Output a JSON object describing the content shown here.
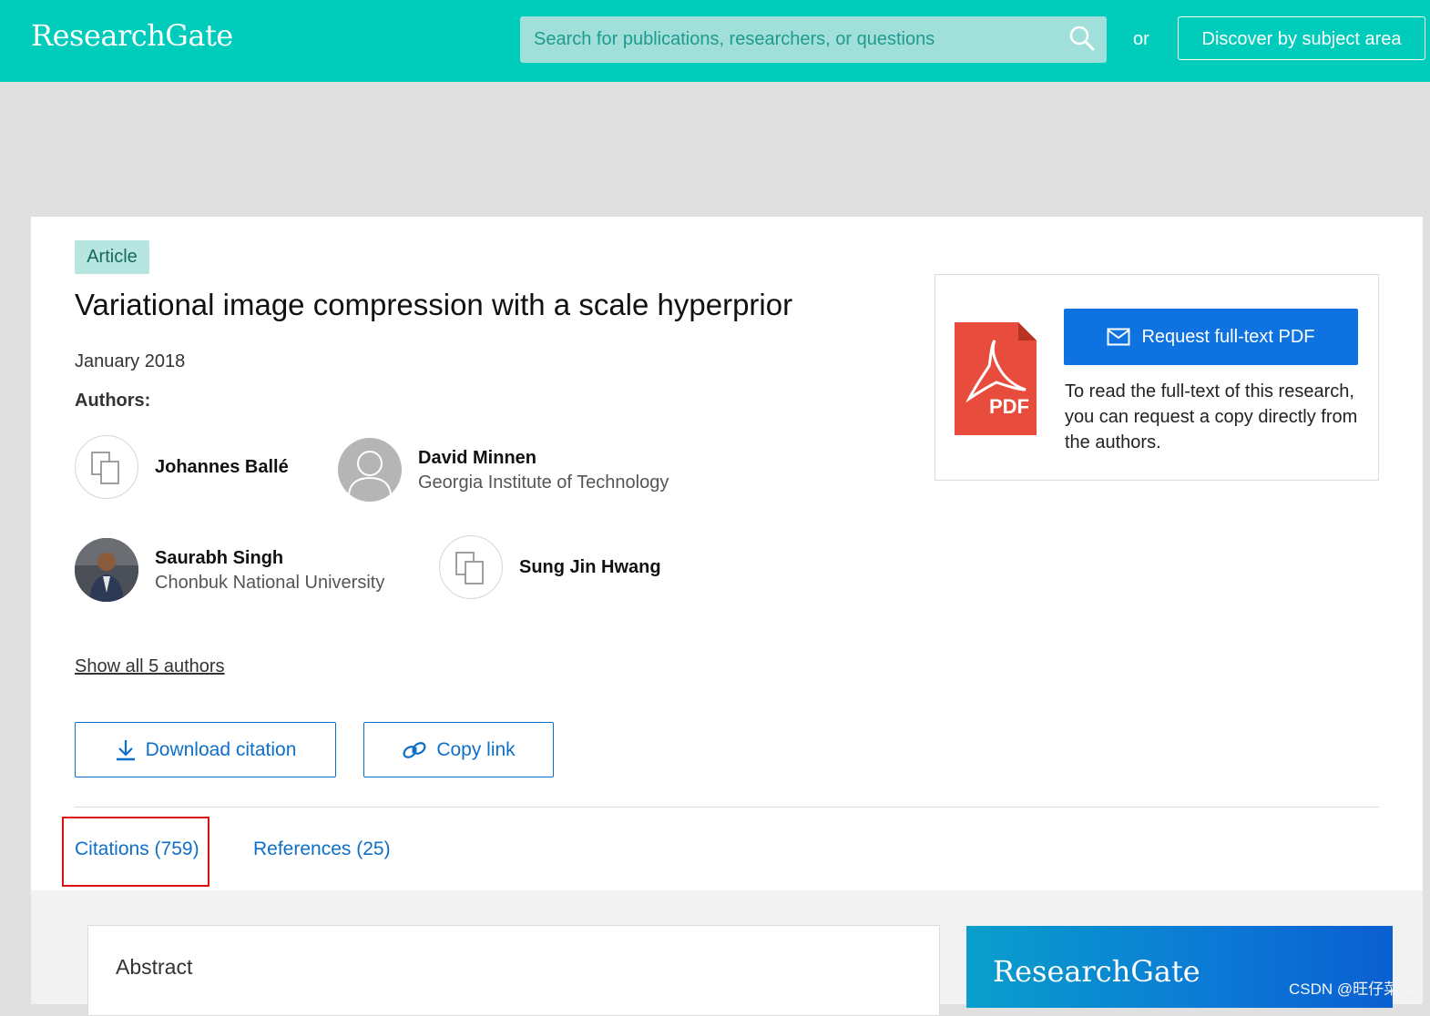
{
  "header": {
    "logo": "ResearchGate",
    "search_placeholder": "Search for publications, researchers, or questions",
    "or_text": "or",
    "discover_label": "Discover by subject area"
  },
  "article": {
    "type_badge": "Article",
    "title": "Variational image compression with a scale hyperprior",
    "date": "January 2018",
    "authors_label": "Authors:",
    "authors": [
      {
        "name": "Johannes Ballé",
        "affiliation": "",
        "avatar": "placeholder-icon"
      },
      {
        "name": "David Minnen",
        "affiliation": "Georgia Institute of Technology",
        "avatar": "default-person-icon"
      },
      {
        "name": "Saurabh Singh",
        "affiliation": "Chonbuk National University",
        "avatar": "photo"
      },
      {
        "name": "Sung Jin Hwang",
        "affiliation": "",
        "avatar": "placeholder-icon"
      }
    ],
    "show_all_authors": "Show all 5 authors",
    "download_citation": "Download citation",
    "copy_link": "Copy link"
  },
  "tabs": [
    {
      "label": "Citations (759)",
      "highlighted": true
    },
    {
      "label": "References (25)",
      "highlighted": false
    }
  ],
  "fulltext": {
    "pdf_icon_label": "PDF",
    "request_button": "Request full-text PDF",
    "description": "To read the full-text of this research, you can request a copy directly from the authors."
  },
  "lower": {
    "abstract_title": "Abstract",
    "promo_logo": "ResearchGate"
  },
  "watermark": "CSDN @旺仔菜菜",
  "colors": {
    "header_bg": "#00ccbb",
    "link_blue": "#0e6fc8",
    "button_blue": "#0e73e0",
    "highlight_red": "#e01010",
    "pdf_red": "#e84c3d"
  }
}
